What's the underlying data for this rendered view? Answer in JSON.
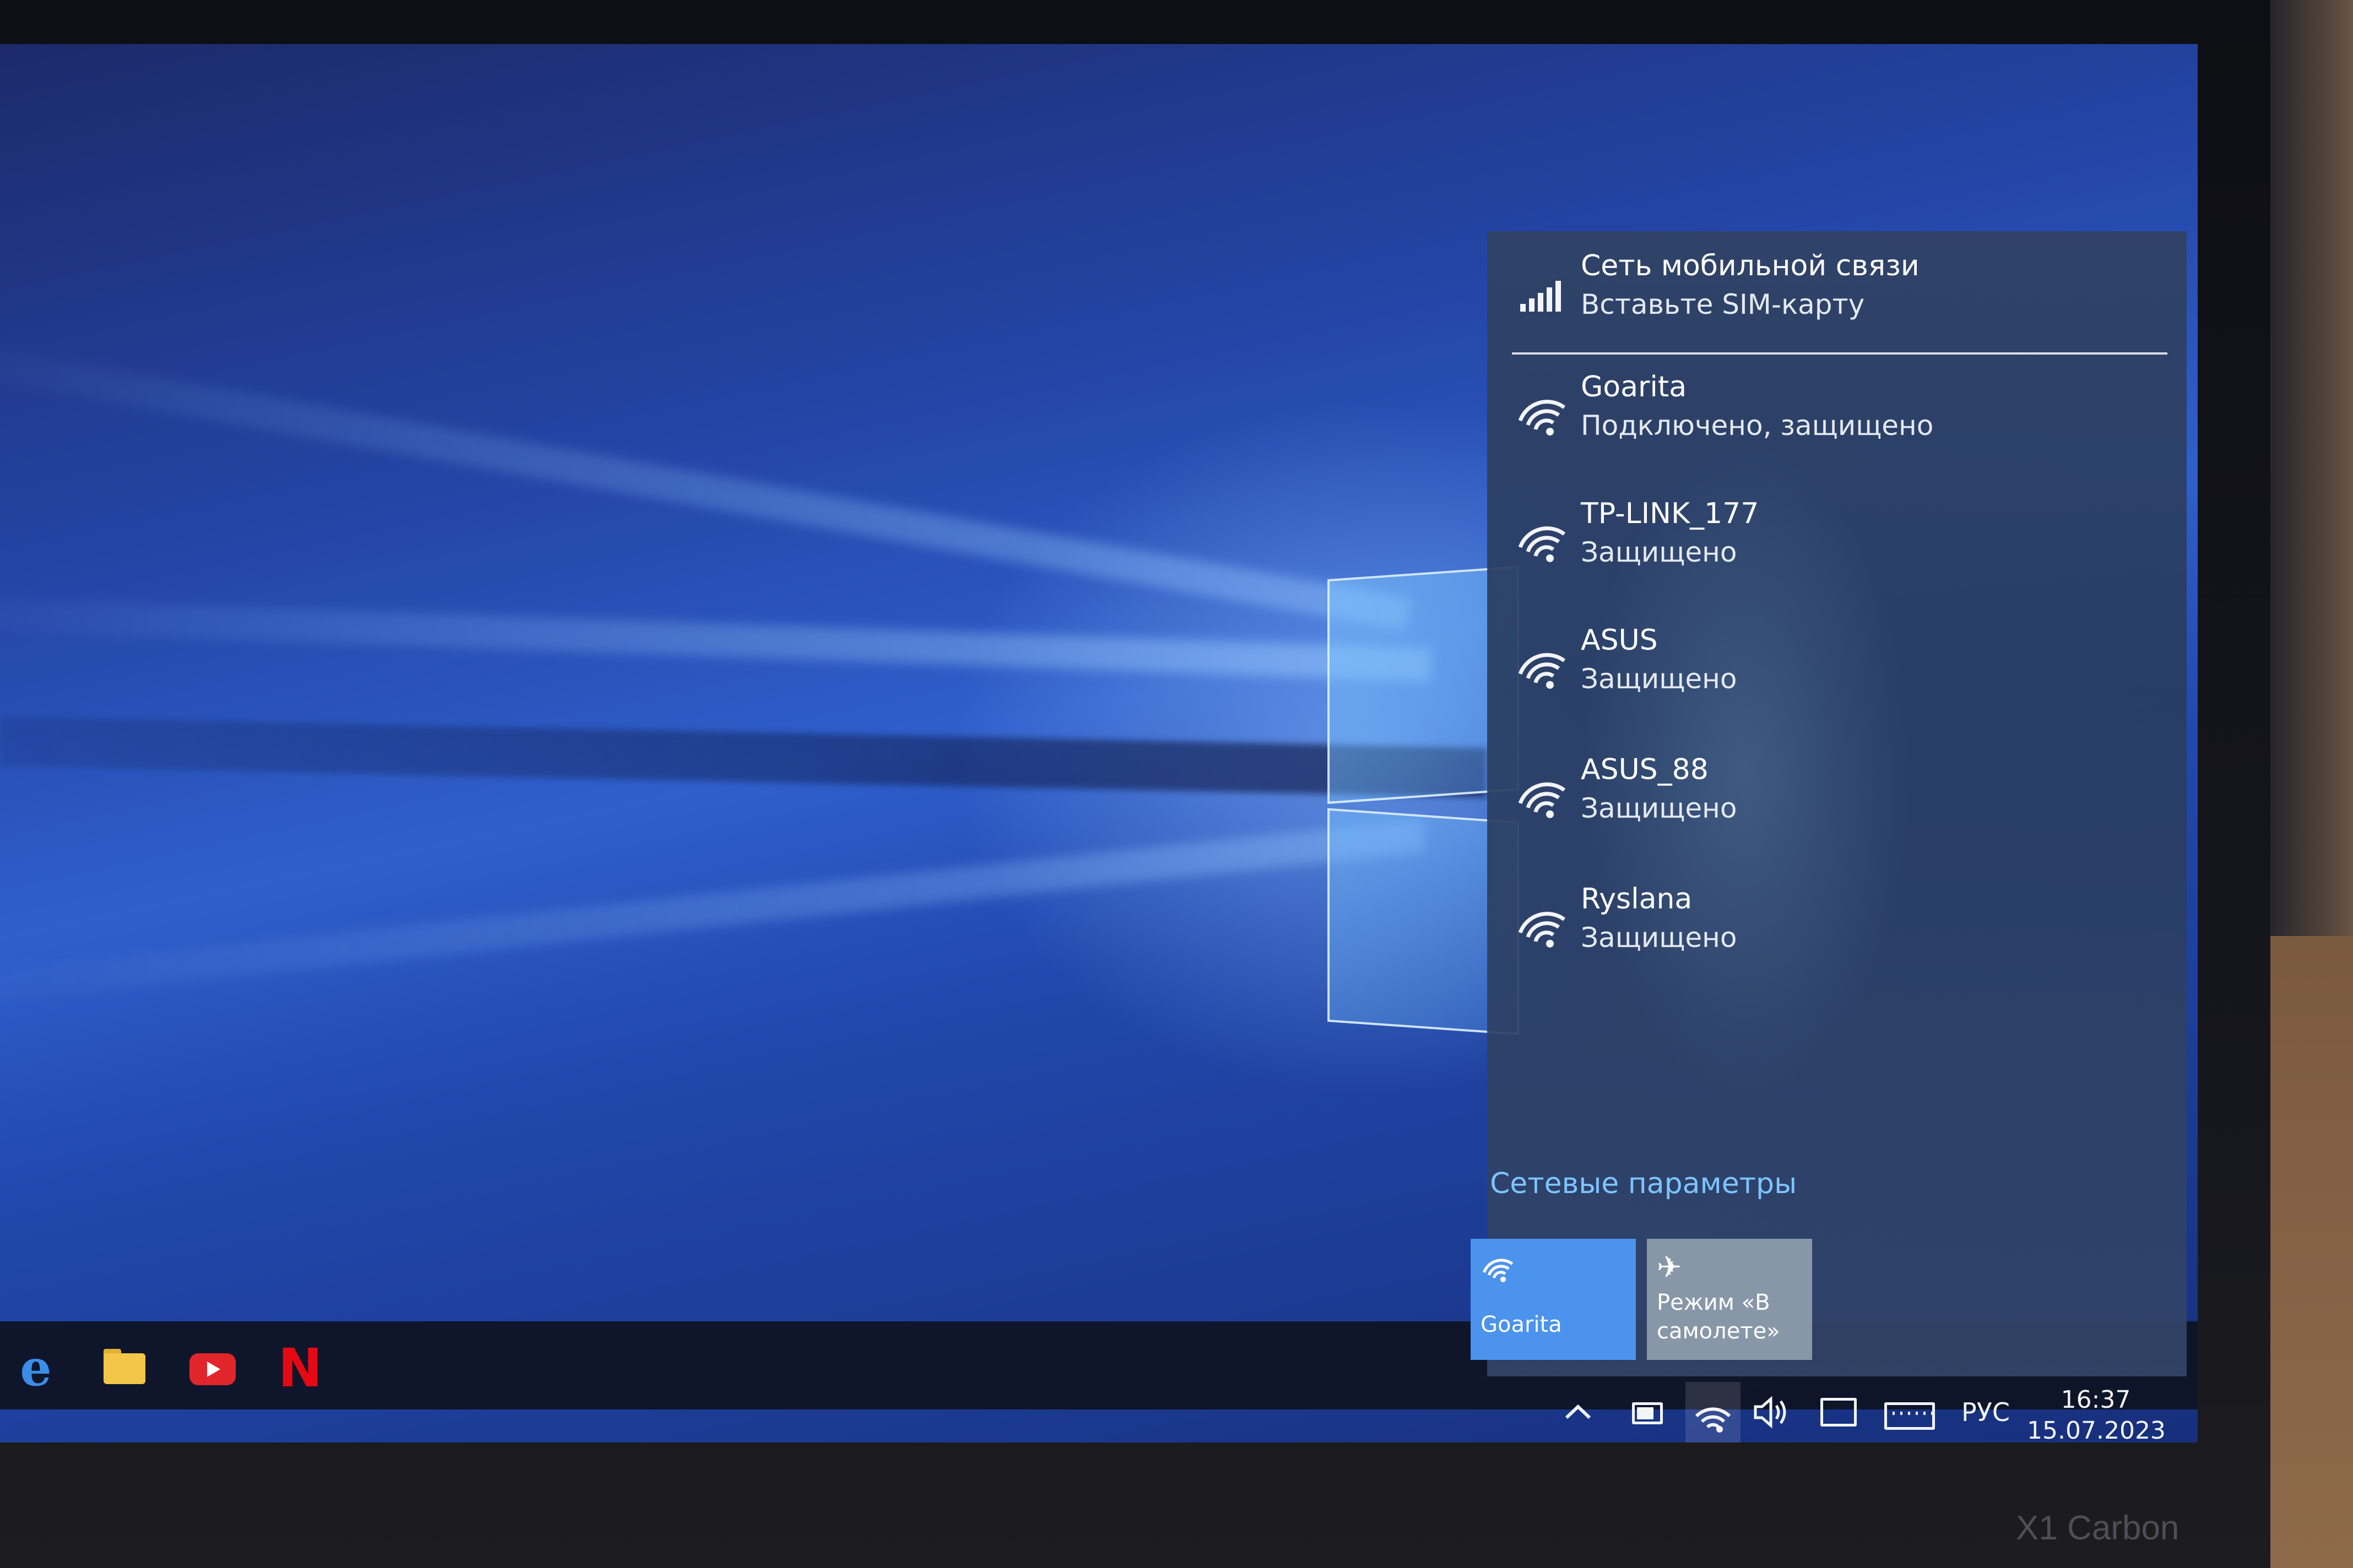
{
  "flyout": {
    "mobile": {
      "title": "Сеть мобильной связи",
      "status": "Вставьте SIM-карту",
      "icon": "cellular-signal-icon"
    },
    "networks": [
      {
        "name": "Goarita",
        "status": "Подключено, защищено",
        "connected": true,
        "icon": "wifi-secured-icon"
      },
      {
        "name": "TP-LINK_177",
        "status": "Защищено",
        "connected": false,
        "icon": "wifi-secured-icon"
      },
      {
        "name": "ASUS",
        "status": "Защищено",
        "connected": false,
        "icon": "wifi-secured-icon"
      },
      {
        "name": "ASUS_88",
        "status": "Защищено",
        "connected": false,
        "icon": "wifi-secured-icon"
      },
      {
        "name": "Ryslana",
        "status": "Защищено",
        "connected": false,
        "icon": "wifi-secured-icon"
      }
    ],
    "settings_link": "Сетевые параметры",
    "quick_actions": [
      {
        "label": "Goarita",
        "active": true,
        "icon": "wifi-icon"
      },
      {
        "label": "Режим «В самолете»",
        "active": false,
        "icon": "airplane-icon"
      }
    ]
  },
  "taskbar": {
    "pinned": [
      {
        "name": "edge",
        "icon": "edge-icon"
      },
      {
        "name": "file-explorer",
        "icon": "folder-icon"
      },
      {
        "name": "youtube",
        "icon": "youtube-icon"
      },
      {
        "name": "netflix",
        "icon": "netflix-icon",
        "glyph": "N"
      }
    ],
    "tray": {
      "language": "РУС",
      "time": "16:37",
      "date": "15.07.2023"
    }
  },
  "device_label": "X1 Carbon",
  "colors": {
    "accent": "#4b93ec",
    "link": "#7ec4ff",
    "flyout_bg": "#304266",
    "taskbar_bg": "#0e1222"
  }
}
